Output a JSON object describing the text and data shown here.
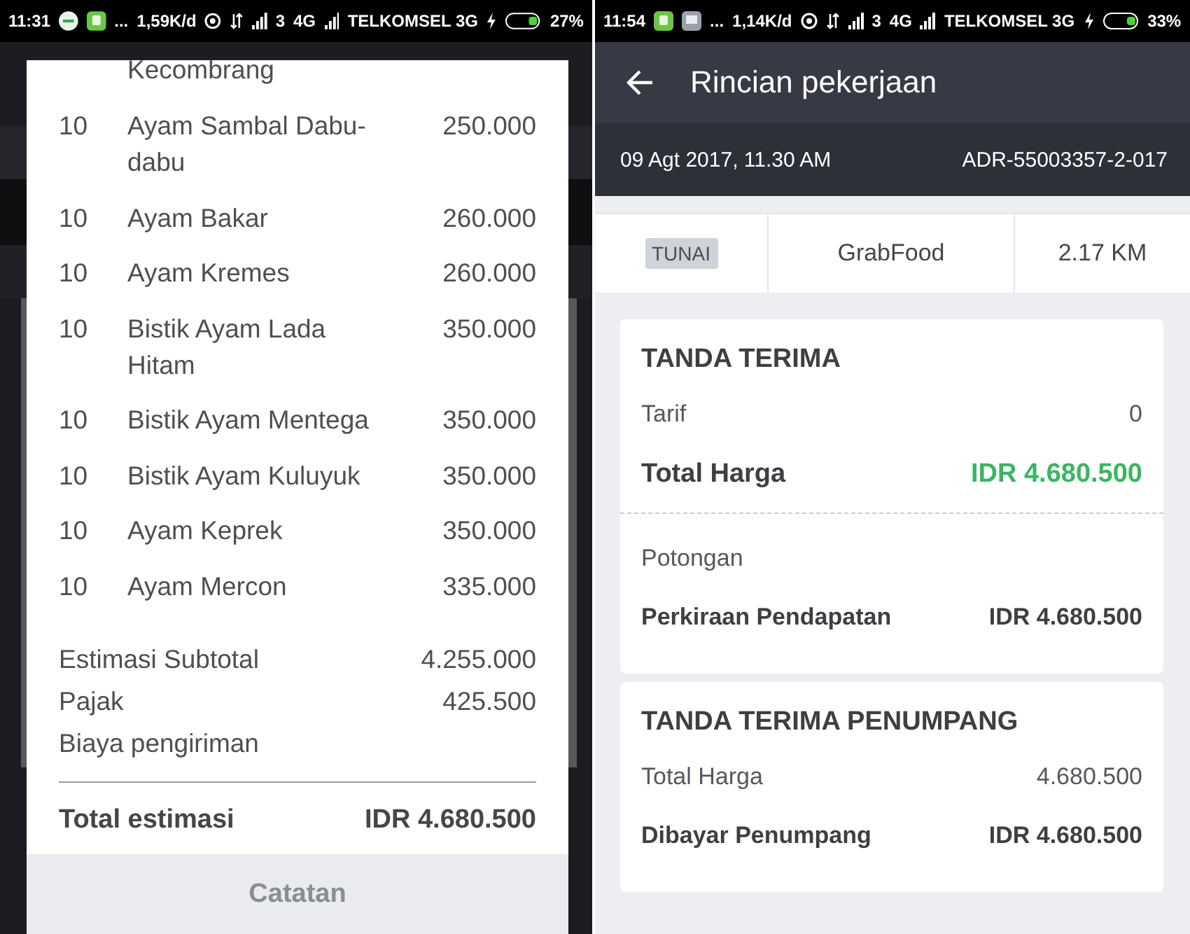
{
  "screens": [
    {
      "status_bar": {
        "time": "11:31",
        "apps": [
          {
            "kind": "grab"
          },
          {
            "kind": "green"
          }
        ],
        "more": "...",
        "speed": "1,59K/d",
        "sim": "3",
        "network": "4G",
        "carrier": "TELKOMSEL 3G",
        "battery": "27%"
      },
      "dialog": {
        "continuation": "Kecombrang",
        "items": [
          {
            "qty": "10",
            "name": "Ayam Sambal Dabu-dabu",
            "price": "250.000"
          },
          {
            "qty": "10",
            "name": "Ayam Bakar",
            "price": "260.000"
          },
          {
            "qty": "10",
            "name": "Ayam Kremes",
            "price": "260.000"
          },
          {
            "qty": "10",
            "name": "Bistik Ayam Lada Hitam",
            "price": "350.000"
          },
          {
            "qty": "10",
            "name": "Bistik Ayam Mentega",
            "price": "350.000"
          },
          {
            "qty": "10",
            "name": "Bistik Ayam Kuluyuk",
            "price": "350.000"
          },
          {
            "qty": "10",
            "name": "Ayam Keprek",
            "price": "350.000"
          },
          {
            "qty": "10",
            "name": "Ayam Mercon",
            "price": "335.000"
          }
        ],
        "summary": [
          {
            "label": "Estimasi Subtotal",
            "value": "4.255.000"
          },
          {
            "label": "Pajak",
            "value": "425.500"
          },
          {
            "label": "Biaya pengiriman"
          }
        ],
        "total": {
          "label": "Total estimasi",
          "value": "IDR 4.680.500"
        },
        "footer_button": "Catatan"
      }
    },
    {
      "status_bar": {
        "time": "11:54",
        "apps": [
          {
            "kind": "green"
          },
          {
            "kind": "chat"
          }
        ],
        "more": "...",
        "speed": "1,14K/d",
        "sim": "3",
        "network": "4G",
        "carrier": "TELKOMSEL 3G",
        "battery": "33%"
      },
      "header": {
        "title": "Rincian pekerjaan"
      },
      "subheader": {
        "date": "09 Agt 2017, 11.30 AM",
        "order_id": "ADR-55003357-2-017"
      },
      "info_strip": {
        "payment": "TUNAI",
        "service": "GrabFood",
        "distance": "2.17 KM"
      },
      "cards": [
        {
          "title": "TANDA TERIMA",
          "rows": [
            {
              "kind": "normal",
              "label": "Tarif",
              "value": "0"
            },
            {
              "kind": "total",
              "label": "Total Harga",
              "value": "IDR 4.680.500"
            },
            {
              "kind": "divider"
            },
            {
              "kind": "normal",
              "label": "Potongan"
            },
            {
              "kind": "emphasis",
              "label": "Perkiraan Pendapatan",
              "value": "IDR 4.680.500"
            }
          ]
        },
        {
          "title": "TANDA TERIMA PENUMPANG",
          "rows": [
            {
              "kind": "normal",
              "label": "Total Harga",
              "value": "4.680.500"
            },
            {
              "kind": "emphasis",
              "label": "Dibayar Penumpang",
              "value": "IDR 4.680.500"
            }
          ]
        }
      ]
    }
  ]
}
